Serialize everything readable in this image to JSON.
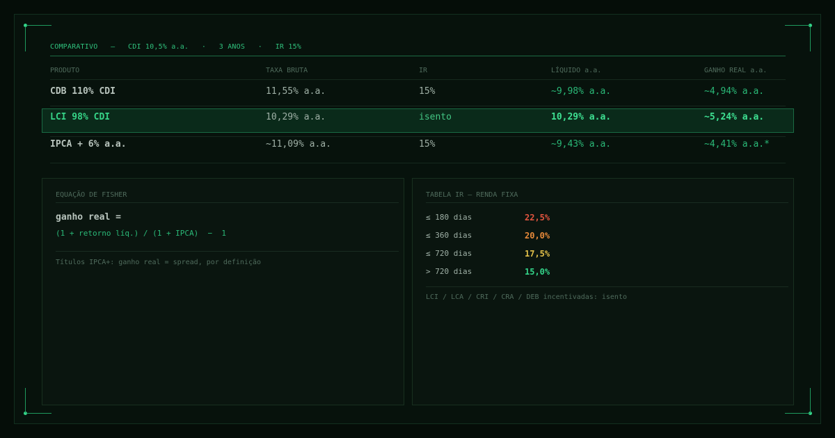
{
  "header": {
    "label": "COMPARATIVO",
    "sep": "—",
    "cdi": "CDI 10,5% a.a.",
    "dot1": "·",
    "period": "3 ANOS",
    "dot2": "·",
    "ir": "IR 15%"
  },
  "table": {
    "columns": [
      "PRODUTO",
      "TAXA BRUTA",
      "IR",
      "LÍQUIDO a.a.",
      "GANHO REAL a.a."
    ],
    "rows": [
      {
        "produto": "CDB 110% CDI",
        "taxa": "11,55% a.a.",
        "ir": "15%",
        "liquido": "~9,98% a.a.",
        "ganho": "~4,94% a.a."
      },
      {
        "produto": "LCI 98% CDI",
        "taxa": "10,29% a.a.",
        "ir": "isento",
        "liquido": "10,29% a.a.",
        "ganho": "~5,24% a.a.",
        "highlighted": true
      },
      {
        "produto": "IPCA + 6% a.a.",
        "taxa": "~11,09% a.a.",
        "ir": "15%",
        "liquido": "~9,43% a.a.",
        "ganho": "~4,41% a.a.*"
      }
    ]
  },
  "fisher": {
    "title": "EQUAÇÃO DE FISHER",
    "label": "ganho real =",
    "equation": "(1 + retorno líq.) / (1 + IPCA)  −  1",
    "note": "Títulos IPCA+: ganho real = spread, por definição"
  },
  "ir_table": {
    "title": "TABELA IR — RENDA FIXA",
    "rows": [
      {
        "days": "≤ 180 dias",
        "rate": "22,5%",
        "color": "#e2553f"
      },
      {
        "days": "≤ 360 dias",
        "rate": "20,0%",
        "color": "#e88a3a"
      },
      {
        "days": "≤ 720 dias",
        "rate": "17,5%",
        "color": "#e2c04a"
      },
      {
        "days": "> 720 dias",
        "rate": "15,0%",
        "color": "#34d58a"
      }
    ],
    "note": "LCI / LCA / CRI / CRA / DEB incentivadas: isento"
  },
  "colors": {
    "accent": "#34d58a",
    "background": "#050d08"
  }
}
